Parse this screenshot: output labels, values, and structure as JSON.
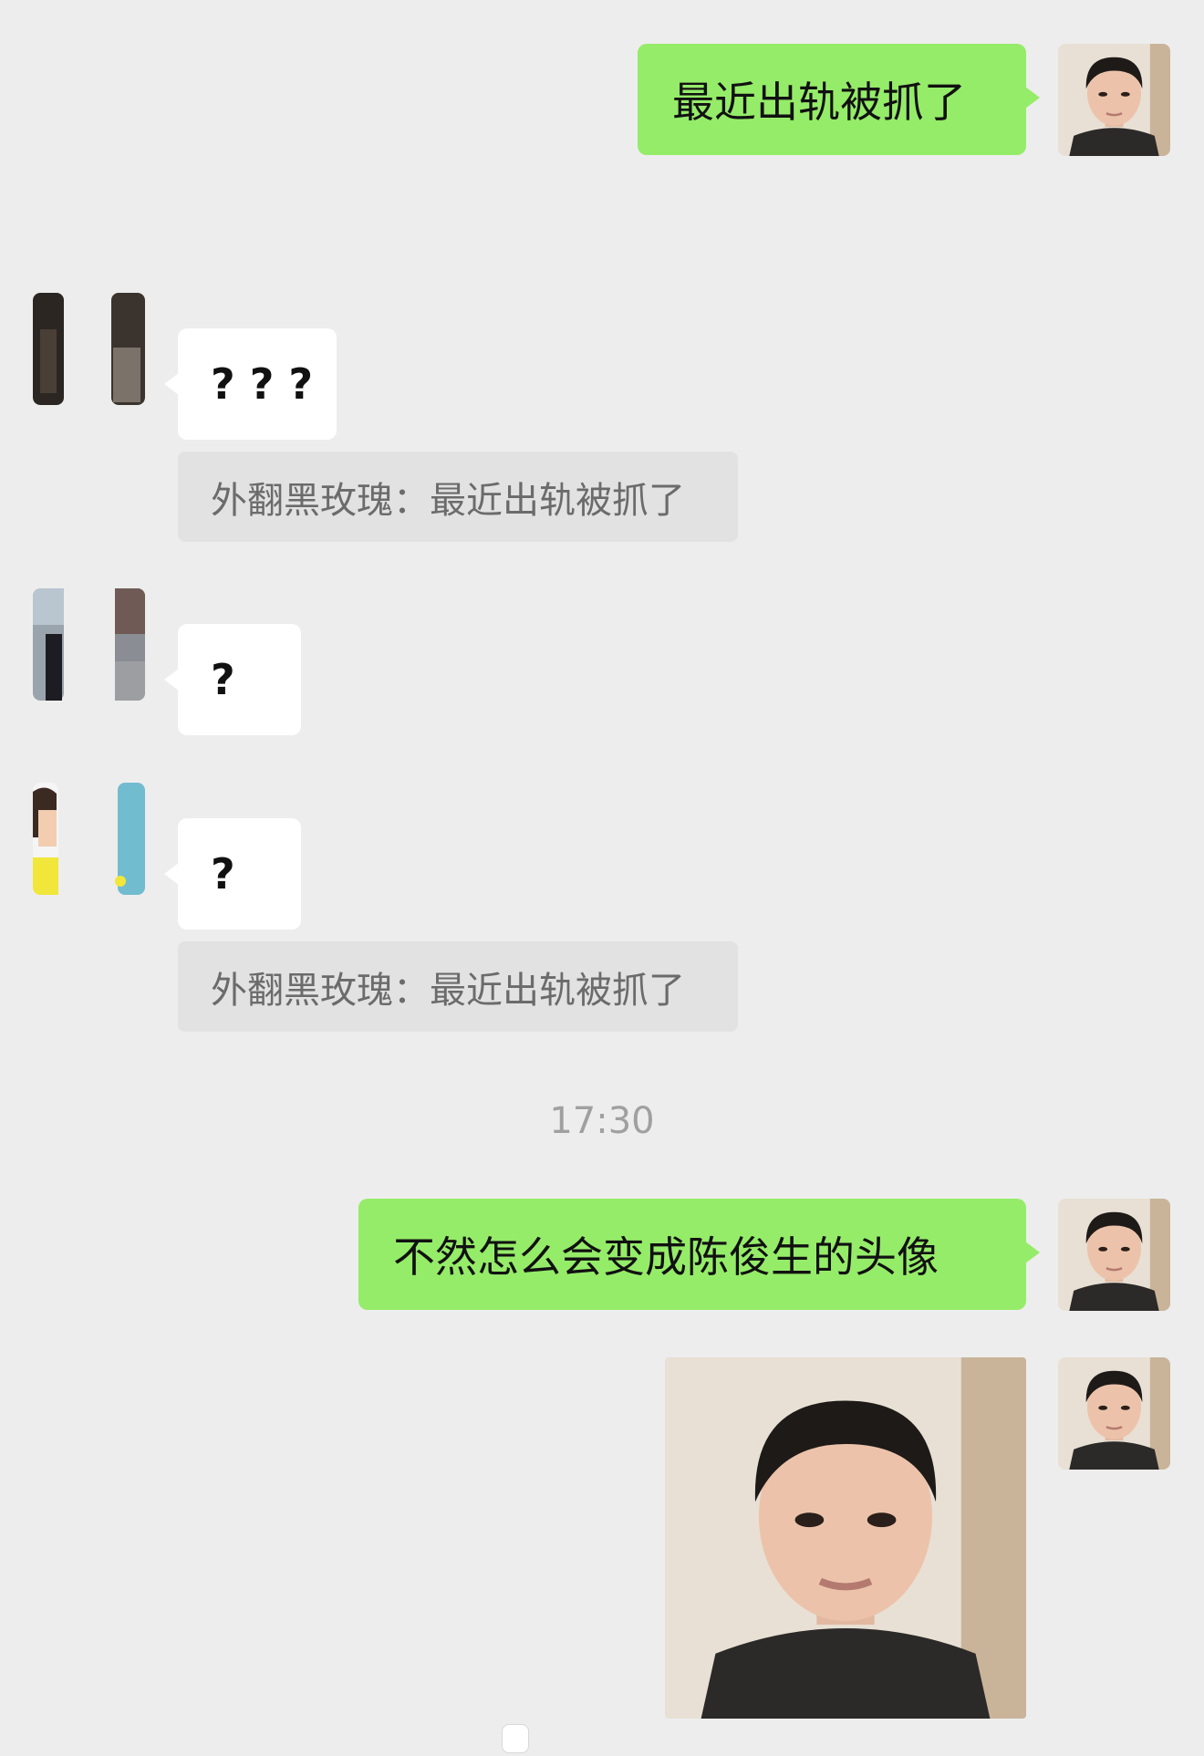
{
  "messages": [
    {
      "type": "sent",
      "text": "最近出轨被抓了",
      "avatar_icon": "man-portrait-avatar"
    },
    {
      "type": "received",
      "text": "? ? ?",
      "avatar_icon": "cropped-dark-photo-avatar",
      "quote": {
        "author": "外翻黑玫瑰",
        "text": "最近出轨被抓了"
      }
    },
    {
      "type": "received",
      "text": "?",
      "avatar_icon": "cropped-street-photo-avatar"
    },
    {
      "type": "received",
      "text": "?",
      "avatar_icon": "cropped-cartoon-avatar",
      "quote": {
        "author": "外翻黑玫瑰",
        "text": "最近出轨被抓了"
      }
    },
    {
      "type": "timestamp",
      "text": "17:30"
    },
    {
      "type": "sent",
      "text": "不然怎么会变成陈俊生的头像",
      "avatar_icon": "man-portrait-avatar"
    },
    {
      "type": "sent-image",
      "image_icon": "man-portrait-photo",
      "avatar_icon": "man-portrait-avatar"
    }
  ],
  "quote_separator": "：",
  "colors": {
    "background": "#ededed",
    "sent_bubble": "#95ec69",
    "received_bubble": "#ffffff",
    "quote_bg": "#e2e2e2",
    "quote_text": "#6b6b6b",
    "timestamp_text": "#a0a0a0"
  }
}
